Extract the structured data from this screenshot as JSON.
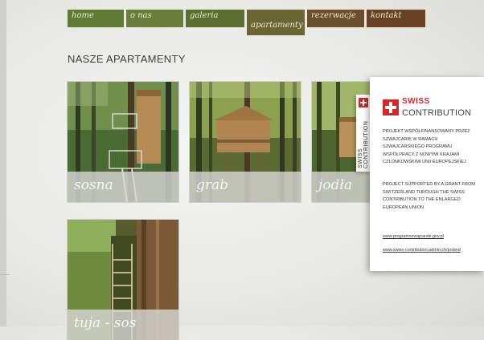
{
  "nav": {
    "items": [
      {
        "label": "home",
        "color": "#5f7b34"
      },
      {
        "label": "o nas",
        "color": "#6a7d3a"
      },
      {
        "label": "galeria",
        "color": "#5d6f2f"
      },
      {
        "label": "apartamenty",
        "color": "#6b6433",
        "active": true
      },
      {
        "label": "rezerwacje",
        "color": "#6b4f2c"
      },
      {
        "label": "kontakt",
        "color": "#694226"
      }
    ]
  },
  "heading": "NASZE APARTAMENTY",
  "apartments": [
    {
      "name": "sosna",
      "icon": "treehouse-photo"
    },
    {
      "name": "grab",
      "icon": "treehouse-photo"
    },
    {
      "name": "jodła",
      "icon": "treehouse-photo"
    },
    {
      "name": "tuja - sos",
      "icon": "treehouse-stairs-photo"
    }
  ],
  "popup": {
    "tab_text": "SWISS CONTRIBUTION",
    "logo_swiss": "SWISS",
    "logo_contribution": "CONTRIBUTION",
    "text_pl": "PROJEKT WSPÓŁFINANSOWANY PRZEZ SZWAJCARIĘ W RAMACH SZWAJCARSKIEGO PROGRAMU WSPÓŁPRACY Z NOWYMI KRAJAMI CZŁONKOWSKIMI UNII EUROPEJSKIEJ",
    "text_en": "PROJECT SUPPORTED BY A GRANT FROM SWITZERLAND THROUGH THE SWISS CONTRIBUTION TO THE ENLARGED EUROPEAN UNION",
    "link1": "www.programszwajcarski.gov.pl",
    "link2": "www.swiss-contribution.admin.ch/poland",
    "accent": "#d7262a"
  }
}
